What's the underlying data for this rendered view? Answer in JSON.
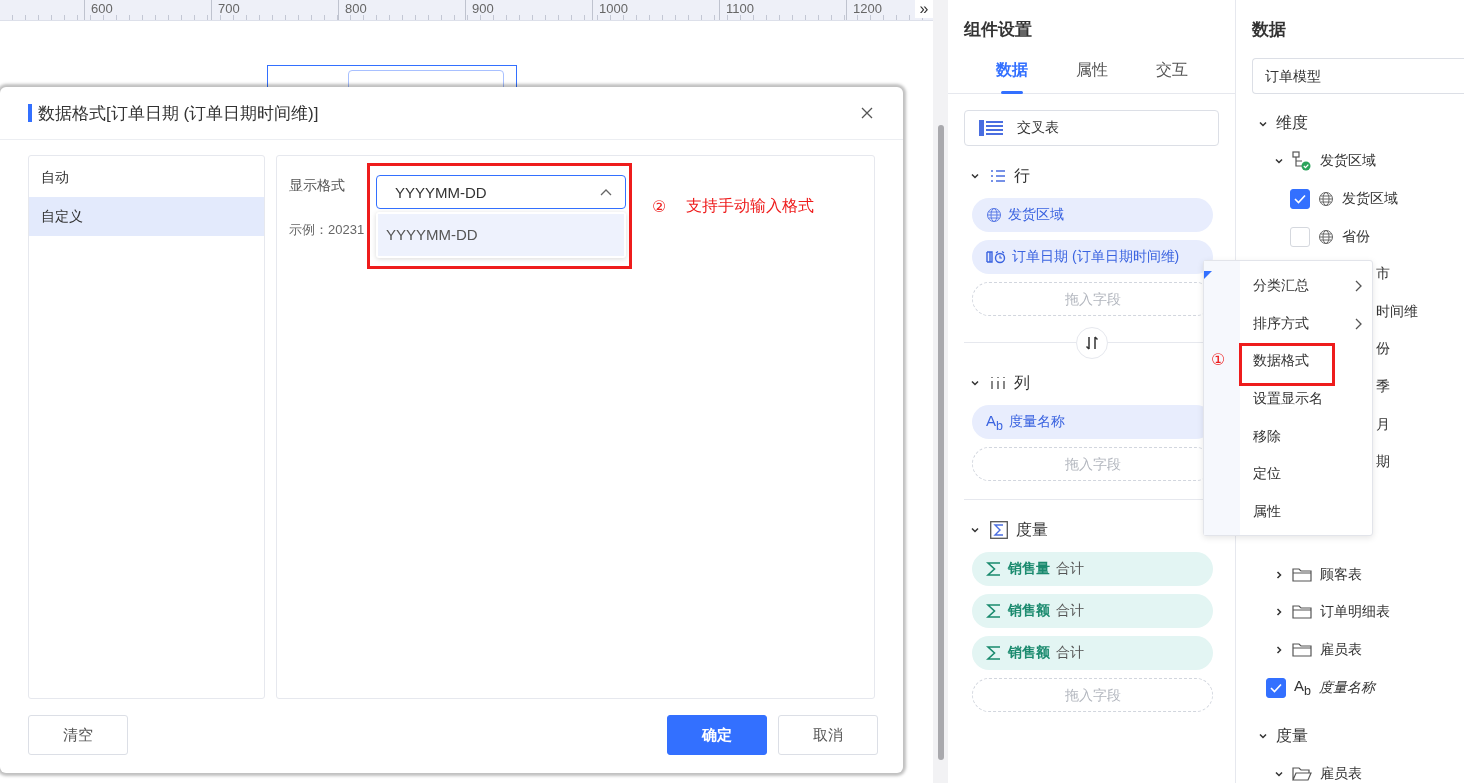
{
  "ruler": [
    "600",
    "700",
    "800",
    "900",
    "1000",
    "1100",
    "1200"
  ],
  "ruler_more": "»",
  "dialog": {
    "title": "数据格式[订单日期 (订单日期时间维)]",
    "format_types": [
      {
        "label": "自动",
        "selected": false
      },
      {
        "label": "自定义",
        "selected": true
      }
    ],
    "format_label": "显示格式",
    "format_value": "YYYYMM-DD",
    "dropdown_open": true,
    "options": [
      {
        "label": "YYYYMM-DD",
        "selected": true
      }
    ],
    "example": "示例：20231",
    "annotation": {
      "marker": "②",
      "text": "支持手动输入格式"
    },
    "buttons": [
      {
        "label": "清空",
        "kind": "default"
      },
      {
        "label": "确定",
        "kind": "primary"
      },
      {
        "label": "取消",
        "kind": "default"
      }
    ]
  },
  "settings": {
    "title": "组件设置",
    "tabs": [
      {
        "label": "数据",
        "selected": true
      },
      {
        "label": "属性",
        "selected": false
      },
      {
        "label": "交互",
        "selected": false
      }
    ],
    "chart_type": "交叉表",
    "sections": [
      {
        "label": "行",
        "kind": "rows",
        "expanded": true,
        "fields": [
          {
            "label": "发货区域",
            "kind": "dimension"
          },
          {
            "label": "订单日期 (订单日期时间维)",
            "kind": "date"
          }
        ],
        "drop": "拖入字段"
      },
      {
        "label": "列",
        "kind": "columns",
        "expanded": true,
        "fields": [
          {
            "label": "度量名称",
            "kind": "measure-name",
            "badge": "A$_{b}$"
          }
        ],
        "drop": "拖入字段"
      },
      {
        "label": "度量",
        "kind": "measures",
        "expanded": true,
        "fields": [
          {
            "label": "销售量",
            "agg": "合计",
            "kind": "measure"
          },
          {
            "label": "销售额",
            "agg": "合计",
            "kind": "measure"
          },
          {
            "label": "销售额",
            "agg": "合计",
            "kind": "measure"
          }
        ],
        "drop": "拖入字段"
      }
    ]
  },
  "context_menu": {
    "marker": "①",
    "items": [
      {
        "label": "分类汇总",
        "submenu": true,
        "highlighted": false
      },
      {
        "label": "排序方式",
        "submenu": true,
        "highlighted": false
      },
      {
        "label": "数据格式",
        "submenu": false,
        "highlighted": true
      },
      {
        "label": "设置显示名",
        "submenu": false,
        "highlighted": false
      },
      {
        "label": "移除",
        "submenu": false,
        "highlighted": false
      },
      {
        "label": "定位",
        "submenu": false,
        "highlighted": false
      },
      {
        "label": "属性",
        "submenu": false,
        "highlighted": false
      }
    ]
  },
  "data_panel": {
    "title": "数据",
    "model": "订单模型",
    "dimensions": {
      "label": "维度",
      "expanded": true,
      "children": [
        {
          "label": "发货区域",
          "kind": "hierarchy",
          "expanded": true,
          "children": [
            {
              "label": "发货区域",
              "kind": "field",
              "checked": true
            },
            {
              "label": "省份",
              "kind": "field",
              "checked": false
            },
            {
              "label": "市",
              "kind": "partial"
            }
          ]
        },
        {
          "label": "时间维",
          "kind": "partial",
          "children": [
            {
              "label": "份",
              "kind": "partial"
            },
            {
              "label": "季",
              "kind": "partial"
            },
            {
              "label": "月",
              "kind": "partial"
            },
            {
              "label": "期",
              "kind": "partial"
            }
          ]
        }
      ],
      "tables": [
        {
          "label": "顾客表",
          "expanded": false
        },
        {
          "label": "订单明细表",
          "expanded": false
        },
        {
          "label": "雇员表",
          "expanded": false
        }
      ],
      "measure_name": {
        "label": "度量名称",
        "badge": "A$_{b}$",
        "checked": true
      }
    },
    "measures": {
      "label": "度量",
      "expanded": true,
      "tables": [
        {
          "label": "雇员表",
          "expanded": true
        }
      ]
    }
  }
}
